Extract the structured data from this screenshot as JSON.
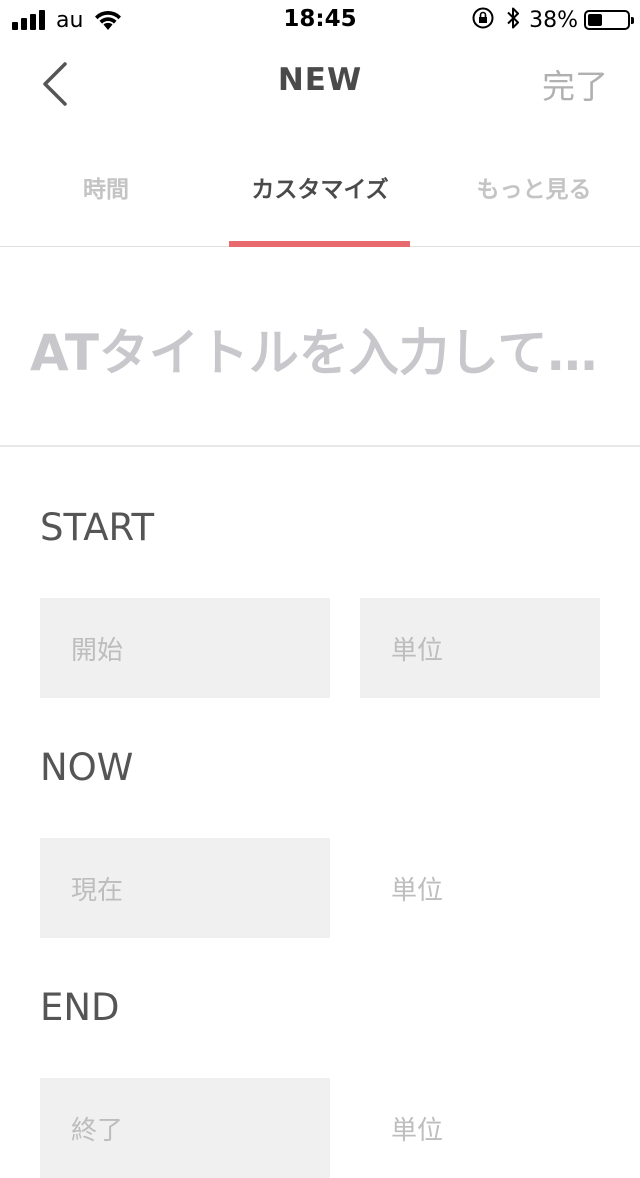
{
  "status_bar": {
    "carrier": "au",
    "time": "18:45",
    "battery_percent": "38%",
    "battery_level": 0.38,
    "icons": [
      "signal-icon",
      "wifi-icon",
      "orientation-lock-icon",
      "bluetooth-icon",
      "battery-icon"
    ]
  },
  "nav": {
    "title": "NEW",
    "done_label": "完了",
    "back_icon": "chevron-left-icon"
  },
  "tabs": [
    {
      "label": "時間",
      "active": false
    },
    {
      "label": "カスタマイズ",
      "active": true
    },
    {
      "label": "もっと見る",
      "active": false
    }
  ],
  "colors": {
    "accent": "#e8696e",
    "field_bg": "#f0f0f0",
    "placeholder": "#bdbdbd"
  },
  "title_input": {
    "placeholder": "ATタイトルを入力して…"
  },
  "sections": {
    "start": {
      "label": "START",
      "value_placeholder": "開始",
      "unit_placeholder": "単位"
    },
    "now": {
      "label": "NOW",
      "value_placeholder": "現在",
      "unit_placeholder": "単位"
    },
    "end": {
      "label": "END",
      "value_placeholder": "終了",
      "unit_placeholder": "単位"
    }
  }
}
